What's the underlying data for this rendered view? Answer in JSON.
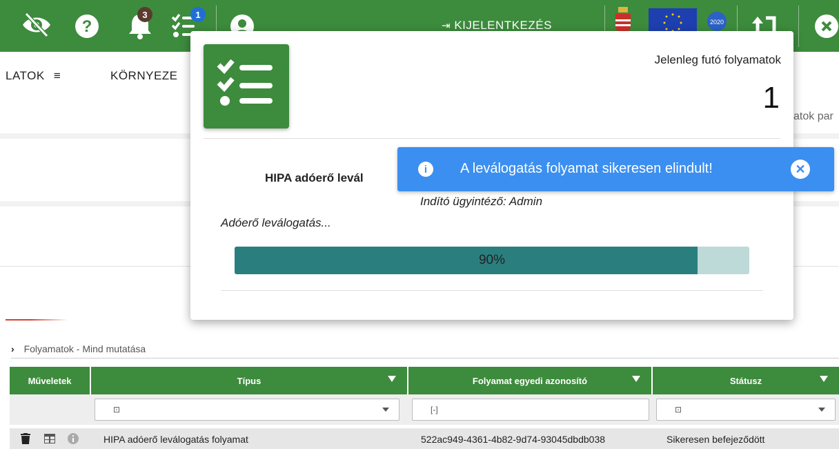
{
  "header": {
    "notifications_count": "3",
    "tasks_count": "1",
    "logout_label": "KIJELENTKEZÉS",
    "eu_2020_label": "2020"
  },
  "nav": {
    "item1": "LATOK",
    "item2": "KÖRNYEZE",
    "partial_right": "atok par"
  },
  "modal": {
    "title": "Jelenleg futó folyamatok",
    "count": "1",
    "job_name": "HIPA adóerő levál",
    "job_starter": "Indító ügyintéző: Admin",
    "job_step": "Adóerő leválogatás...",
    "progress_label": "90%",
    "progress_value": 0.9
  },
  "toast": {
    "info_symbol": "i",
    "message": "A leválogatás folyamat sikeresen elindult!"
  },
  "breadcrumb": {
    "text": "Folyamatok - Mind mutatása"
  },
  "table": {
    "columns": [
      "Műveletek",
      "Típus",
      "Folyamat egyedi azonosító",
      "Státusz"
    ],
    "filters": {
      "tipus_placeholder": "⊡",
      "azonosito_placeholder": "[-]",
      "statusz_placeholder": "⊡"
    },
    "rows": [
      {
        "tipus": "HIPA adóerő leválogatás folyamat",
        "azonosito": "522ac949-4361-4b82-9d74-93045dbdb038",
        "statusz": "Sikeresen befejeződött"
      }
    ]
  },
  "colors": {
    "brand_green": "#3d8b3d",
    "toast_blue": "#3b8ff0",
    "progress_fill": "#2a7f7e",
    "progress_track": "#bdd9d8"
  }
}
